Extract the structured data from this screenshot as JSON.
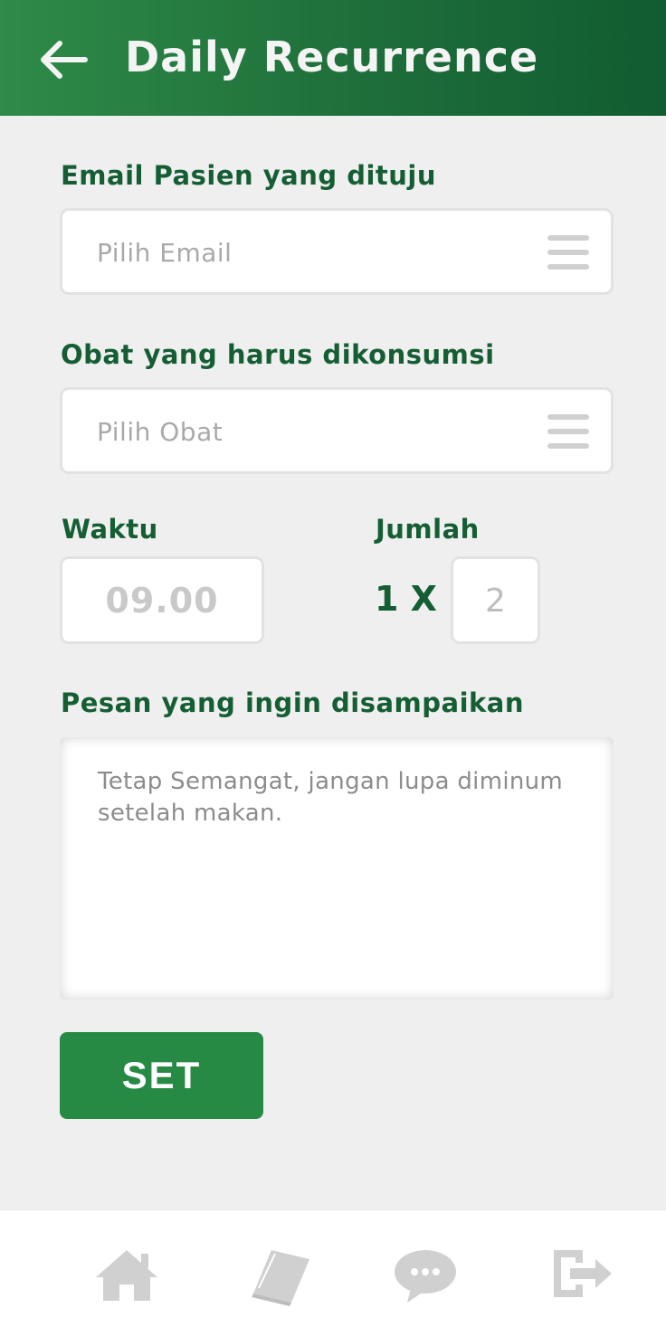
{
  "header": {
    "title": "Daily Recurrence",
    "back_icon": "arrow-left-icon"
  },
  "form": {
    "email": {
      "label": "Email Pasien yang dituju",
      "placeholder": "Pilih Email",
      "icon": "menu-lines-icon"
    },
    "medicine": {
      "label": "Obat yang harus dikonsumsi",
      "placeholder": "Pilih Obat",
      "icon": "menu-lines-icon"
    },
    "time": {
      "label": "Waktu",
      "value": "09.00"
    },
    "amount": {
      "label": "Jumlah",
      "multiplier": "1 X",
      "value": "2"
    },
    "message": {
      "label": "Pesan yang ingin disampaikan",
      "placeholder": "Tetap Semangat, jangan lupa diminum setelah makan."
    },
    "submit_label": "SET"
  },
  "bottom_nav": {
    "items": [
      {
        "icon": "home-icon"
      },
      {
        "icon": "book-icon"
      },
      {
        "icon": "chat-icon"
      },
      {
        "icon": "logout-icon"
      }
    ]
  },
  "colors": {
    "primary_green": "#268a45",
    "dark_green": "#155e33",
    "background": "#efefef"
  }
}
